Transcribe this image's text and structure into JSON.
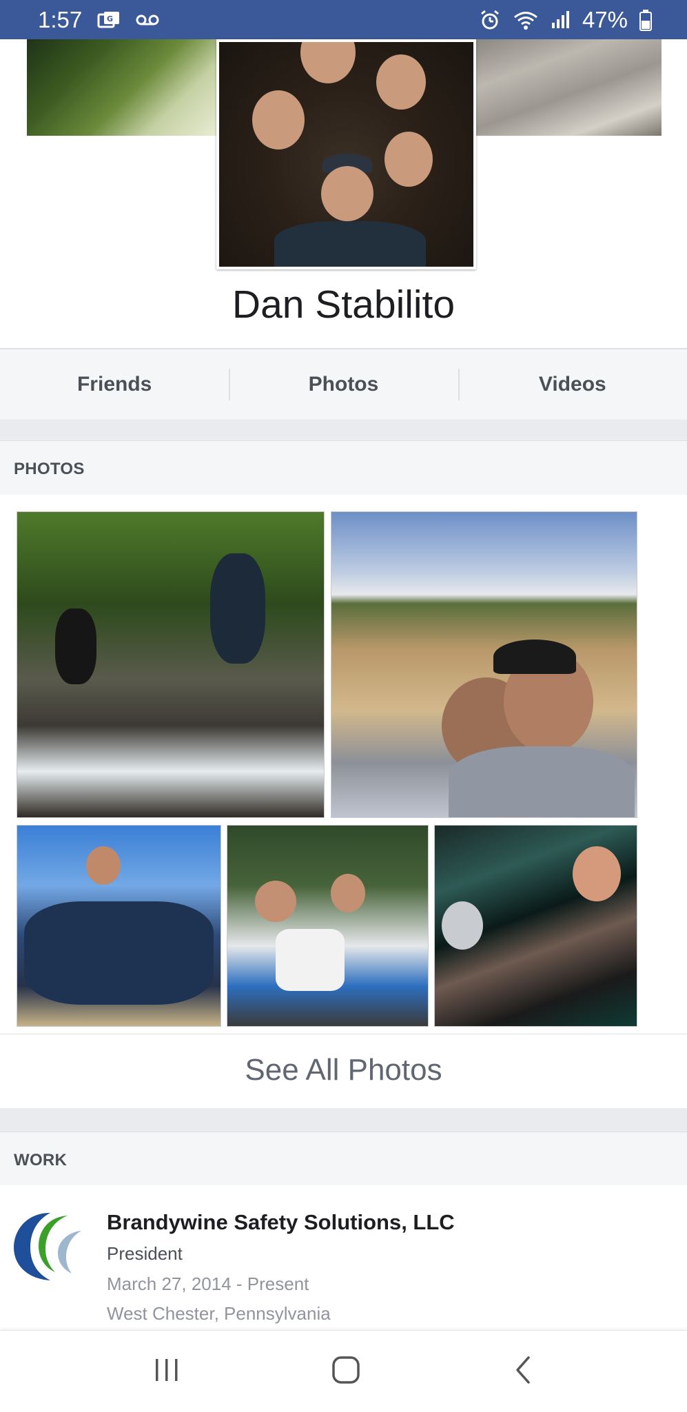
{
  "status_bar": {
    "time": "1:57",
    "battery": "47%",
    "background": "#3b5998",
    "icons_left": [
      "vpn-icon",
      "voicemail-icon"
    ],
    "icons_right": [
      "alarm-icon",
      "wifi-icon",
      "signal-icon",
      "battery-icon"
    ]
  },
  "profile": {
    "name": "Dan Stabilito"
  },
  "tabs": [
    {
      "label": "Friends"
    },
    {
      "label": "Photos"
    },
    {
      "label": "Videos"
    }
  ],
  "photos_section": {
    "header": "PHOTOS",
    "see_all": "See All Photos",
    "thumbnails": [
      "waterfall-family-photo",
      "field-selfie-photo",
      "beach-family-photo",
      "forest-family-photo",
      "trophy-celebration-photo"
    ]
  },
  "work_section": {
    "header": "WORK",
    "items": [
      {
        "company": "Brandywine Safety Solutions, LLC",
        "role": "President",
        "dates": "March 27, 2014 - Present",
        "location": "West Chester, Pennsylvania"
      }
    ]
  },
  "nav_bar": {
    "buttons": [
      "recents-button",
      "home-button",
      "back-button"
    ]
  },
  "colors": {
    "brand": "#3b5998",
    "section_bg": "#f5f6f7",
    "divider": "#e9ebee"
  }
}
